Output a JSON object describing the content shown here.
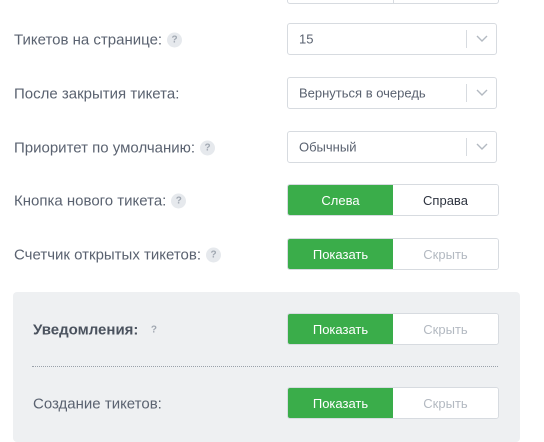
{
  "settings": {
    "tickets_per_page": {
      "label": "Тикетов на странице:",
      "value": "15",
      "help": "?"
    },
    "after_close": {
      "label": "После закрытия тикета:",
      "value": "Вернуться в очередь"
    },
    "default_priority": {
      "label": "Приоритет по умолчанию:",
      "value": "Обычный",
      "help": "?"
    },
    "new_ticket_button": {
      "label": "Кнопка нового тикета:",
      "help": "?",
      "left": "Слева",
      "right": "Справа",
      "selected": "left"
    },
    "open_ticket_counter": {
      "label": "Счетчик открытых тикетов:",
      "help": "?",
      "show": "Показать",
      "hide": "Скрыть",
      "selected": "show"
    }
  },
  "notifications_panel": {
    "notifications": {
      "label": "Уведомления:",
      "help": "?",
      "show": "Показать",
      "hide": "Скрыть",
      "selected": "show"
    },
    "ticket_creation": {
      "label": "Создание тикетов:",
      "show": "Показать",
      "hide": "Скрыть",
      "selected": "show"
    }
  },
  "colors": {
    "accent": "#3aad4a",
    "border": "#d7dbe0",
    "text": "#5a6270",
    "panel_bg": "#eef0f2"
  },
  "icons": {
    "dropdown": "chevron-down-icon",
    "help": "help-icon"
  }
}
